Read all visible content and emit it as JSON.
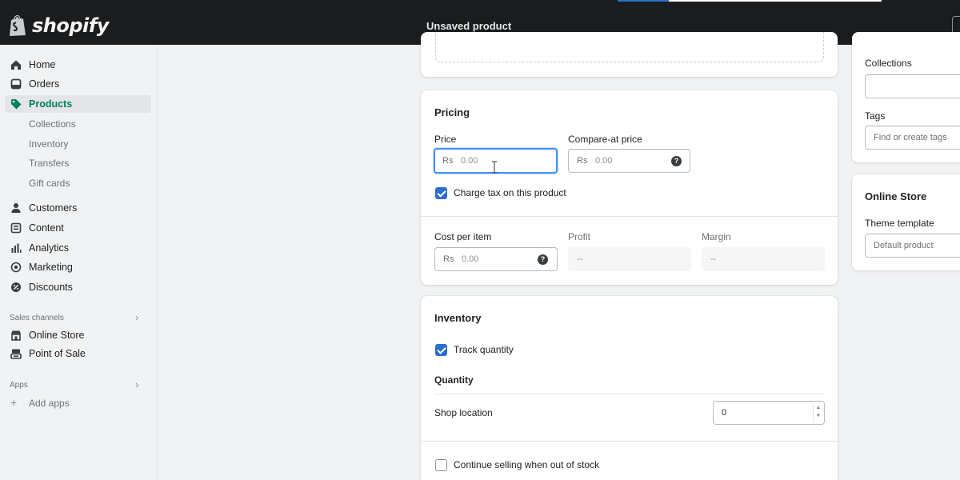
{
  "topbar": {
    "brand": "shopify",
    "page_title": "Unsaved product"
  },
  "sidebar": {
    "items": [
      {
        "label": "Home",
        "icon": "home-icon"
      },
      {
        "label": "Orders",
        "icon": "orders-icon"
      },
      {
        "label": "Products",
        "icon": "tag-icon",
        "active": true
      },
      {
        "label": "Collections",
        "sub": true
      },
      {
        "label": "Inventory",
        "sub": true
      },
      {
        "label": "Transfers",
        "sub": true
      },
      {
        "label": "Gift cards",
        "sub": true
      },
      {
        "label": "Customers",
        "icon": "person-icon"
      },
      {
        "label": "Content",
        "icon": "content-icon"
      },
      {
        "label": "Analytics",
        "icon": "bar-chart-icon"
      },
      {
        "label": "Marketing",
        "icon": "target-icon"
      },
      {
        "label": "Discounts",
        "icon": "discount-icon"
      }
    ],
    "sales_channels_label": "Sales channels",
    "channels": [
      {
        "label": "Online Store",
        "icon": "store-icon"
      },
      {
        "label": "Point of Sale",
        "icon": "pos-icon"
      }
    ],
    "apps_label": "Apps",
    "add_apps": "Add apps"
  },
  "pricing": {
    "title": "Pricing",
    "price_label": "Price",
    "price_prefix": "Rs",
    "price_placeholder": "0.00",
    "compare_label": "Compare-at price",
    "compare_prefix": "Rs",
    "compare_placeholder": "0.00",
    "charge_tax_label": "Charge tax on this product",
    "charge_tax_checked": true,
    "cost_label": "Cost per item",
    "cost_prefix": "Rs",
    "cost_placeholder": "0.00",
    "profit_label": "Profit",
    "profit_value": "--",
    "margin_label": "Margin",
    "margin_value": "--"
  },
  "inventory": {
    "title": "Inventory",
    "track_label": "Track quantity",
    "track_checked": true,
    "quantity_heading": "Quantity",
    "location_label": "Shop location",
    "location_quantity": "0",
    "continue_selling_label": "Continue selling when out of stock",
    "continue_selling_checked": false
  },
  "organization": {
    "collections_label": "Collections",
    "tags_label": "Tags",
    "tags_placeholder": "Find or create tags"
  },
  "online_store": {
    "title": "Online Store",
    "theme_label": "Theme template",
    "theme_value": "Default product"
  },
  "colors": {
    "topbar": "#1a1c1d",
    "accent_green": "#008060",
    "checkbox_blue": "#2c6ecb",
    "focus_blue": "#458fff"
  }
}
